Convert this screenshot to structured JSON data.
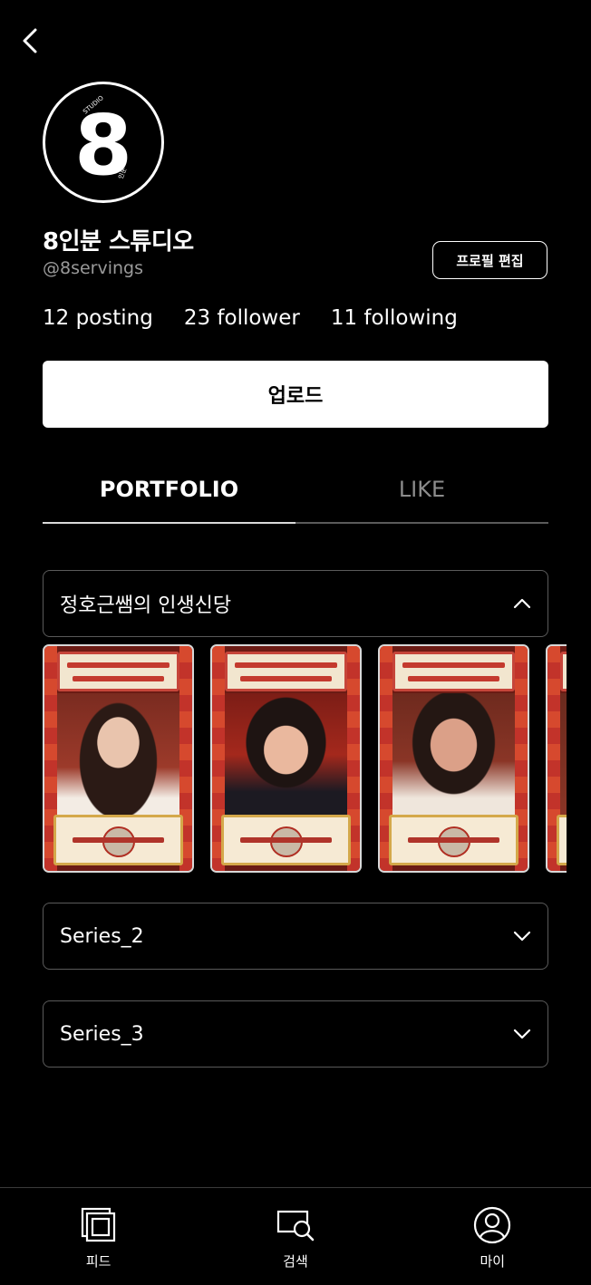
{
  "header": {
    "back_icon": "chevron-left-icon"
  },
  "profile": {
    "avatar_text": "8",
    "avatar_badge_top": "STUDIO",
    "avatar_badge_bottom": "인분",
    "name": "8인분 스튜디오",
    "handle": "@8servings",
    "edit_label": "프로필 편집"
  },
  "stats": {
    "posting": "12 posting",
    "follower": "23 follower",
    "following": "11 following"
  },
  "upload_label": "업로드",
  "tabs": [
    {
      "label": "PORTFOLIO",
      "active": true
    },
    {
      "label": "LIKE",
      "active": false
    }
  ],
  "series": [
    {
      "label": "정호근쌤의 인생신당",
      "expanded": true,
      "icon": "chevron-up-icon"
    },
    {
      "label": "Series_2",
      "expanded": false,
      "icon": "chevron-down-icon"
    },
    {
      "label": "Series_3",
      "expanded": false,
      "icon": "chevron-down-icon"
    }
  ],
  "thumbnails": [
    {
      "name": "video-thumbnail-1"
    },
    {
      "name": "video-thumbnail-2"
    },
    {
      "name": "video-thumbnail-3"
    },
    {
      "name": "video-thumbnail-4"
    }
  ],
  "bottom_nav": [
    {
      "label": "피드",
      "icon": "feed-icon"
    },
    {
      "label": "검색",
      "icon": "search-icon"
    },
    {
      "label": "마이",
      "icon": "user-icon"
    }
  ],
  "colors": {
    "background": "#000000",
    "text": "#ffffff",
    "muted": "#9a9a9a",
    "border": "#5a5a5a"
  }
}
